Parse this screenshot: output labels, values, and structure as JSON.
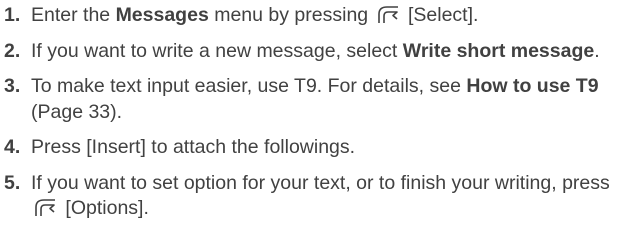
{
  "steps": [
    {
      "number": "1.",
      "pre": "Enter the ",
      "bold": "Messages",
      "mid": " menu by pressing",
      "icon": "softkey-icon",
      "post": "[Select]."
    },
    {
      "number": "2.",
      "pre": "If you want to write a new message, select ",
      "bold": "Write short message",
      "post": "."
    },
    {
      "number": "3.",
      "pre": "To make text input easier, use T9. For details, see ",
      "bold": "How to use T9",
      "post": " (Page 33)."
    },
    {
      "number": "4.",
      "text": "Press [Insert] to attach the followings."
    },
    {
      "number": "5.",
      "pre": "If you want to set option for your text, or to finish your writing, press",
      "icon": "softkey-icon",
      "post": "[Options]."
    }
  ]
}
